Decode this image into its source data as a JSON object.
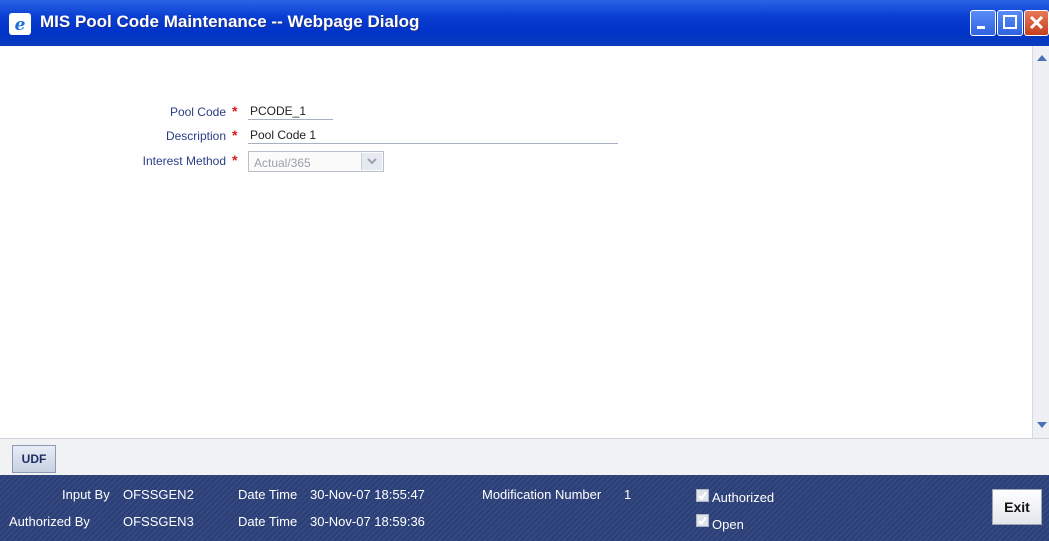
{
  "window": {
    "title": "MIS Pool Code Maintenance -- Webpage Dialog",
    "title_icon": "ie-icon",
    "controls": [
      "minimize-icon",
      "maximize-icon",
      "close-icon"
    ]
  },
  "form": {
    "pool_code": {
      "label": "Pool Code",
      "required_mark": "*",
      "value": "PCODE_1"
    },
    "description": {
      "label": "Description",
      "required_mark": "*",
      "value": "Pool Code 1"
    },
    "interest_method": {
      "label": "Interest Method",
      "required_mark": "*",
      "value": "Actual/365",
      "disabled": true
    }
  },
  "toolbar": {
    "udf_label": "UDF"
  },
  "footer": {
    "input_by_label": "Input By",
    "input_by": "OFSSGEN2",
    "authorized_by_label": "Authorized By",
    "authorized_by": "OFSSGEN3",
    "datetime_label": "Date Time",
    "input_datetime": "30-Nov-07 18:55:47",
    "auth_datetime": "30-Nov-07 18:59:36",
    "modification_label": "Modification Number",
    "modification_number": "1",
    "authorized_label": "Authorized",
    "authorized_checked": true,
    "open_label": "Open",
    "open_checked": true,
    "exit_label": "Exit"
  },
  "colors": {
    "titlebar": "#0033c8",
    "footer": "#2a3f78",
    "label": "#2a3d86",
    "required": "#d91a1a"
  }
}
